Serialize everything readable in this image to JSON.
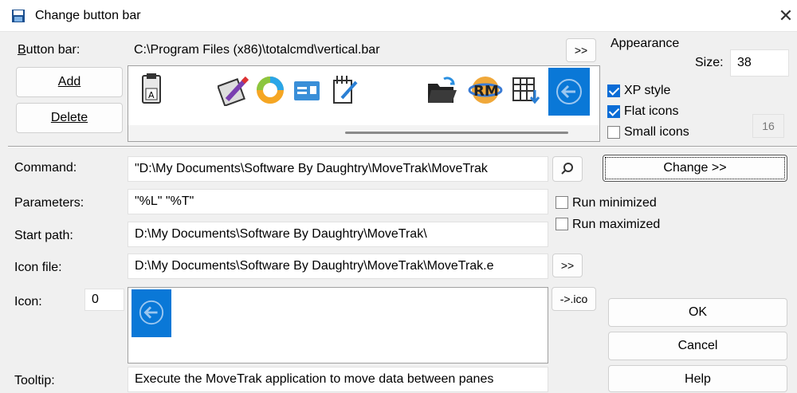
{
  "window": {
    "title": "Change button bar",
    "close_glyph": "✕"
  },
  "button_bar": {
    "label_u": "B",
    "label_rest": "utton bar:",
    "path": "C:\\Program Files (x86)\\totalcmd\\vertical.bar",
    "browse": ">>",
    "add": "Add",
    "delete": "Delete"
  },
  "appearance": {
    "title": "Appearance",
    "size_label": "Size:",
    "size_value": "38",
    "xp_style": "XP style",
    "xp_style_checked": true,
    "flat_icons": "Flat icons",
    "flat_icons_checked": true,
    "small_icons": "Small icons",
    "small_icons_checked": false,
    "small_size": "16"
  },
  "toolbar_icons": [
    "clipboard-icon",
    "pencil-tag-icon",
    "ring-icon",
    "card-icon",
    "edit-list-icon",
    "open-folder-icon",
    "rm-icon",
    "grid-download-icon",
    "back-arrow-icon"
  ],
  "command": {
    "label": "Command:",
    "value": "\"D:\\My Documents\\Software By Daughtry\\MoveTrak\\MoveTrak",
    "change": "Change >>"
  },
  "parameters": {
    "label": "Parameters:",
    "value": "\"%L\" \"%T\""
  },
  "start_path": {
    "label": "Start path:",
    "value": "D:\\My Documents\\Software By Daughtry\\MoveTrak\\"
  },
  "icon_file": {
    "label": "Icon file:",
    "value": "D:\\My Documents\\Software By Daughtry\\MoveTrak\\MoveTrak.e",
    "browse": ">>"
  },
  "icon": {
    "label": "Icon:",
    "index": "0",
    "to_ico": "->.ico"
  },
  "run_minimized": "Run minimized",
  "run_maximized": "Run maximized",
  "tooltip": {
    "label": "Tooltip:",
    "value": "Execute the MoveTrak application to move data between panes"
  },
  "buttons": {
    "ok": "OK",
    "cancel": "Cancel",
    "help": "Help"
  },
  "colors": {
    "accent": "#0a6cd6",
    "selected_icon_bg": "#0a78d7"
  }
}
